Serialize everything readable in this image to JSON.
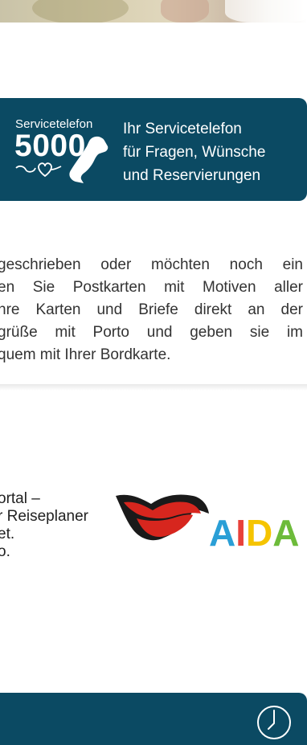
{
  "service_banner": {
    "small_label": "Servicetelefon",
    "number": "5000",
    "lines": [
      "Ihr Servicetelefon",
      "für Fragen, Wünsche",
      "und Reservierungen"
    ]
  },
  "postcard_info": {
    "lines": [
      "geschrieben oder möchten noch ein",
      "en Sie Postkarten mit Motiven aller",
      "hre Karten und Briefe direkt an der",
      "grüße mit Porto und geben sie im",
      "quem mit Ihrer Bordkarte."
    ]
  },
  "portal_info": {
    "lines": [
      "ortal –",
      "r Reiseplaner",
      "et.",
      "o."
    ]
  },
  "logo": {
    "text": "AIDA",
    "letter_colors": [
      "#2a9fd6",
      "#e8413a",
      "#f5c400",
      "#6dbb3a"
    ],
    "lips_color": "#d7261e"
  },
  "colors": {
    "brand_blue": "#0b4a63"
  },
  "icons": {
    "phone": "phone-icon",
    "heart": "heart-icon",
    "clock": "clock-icon"
  }
}
